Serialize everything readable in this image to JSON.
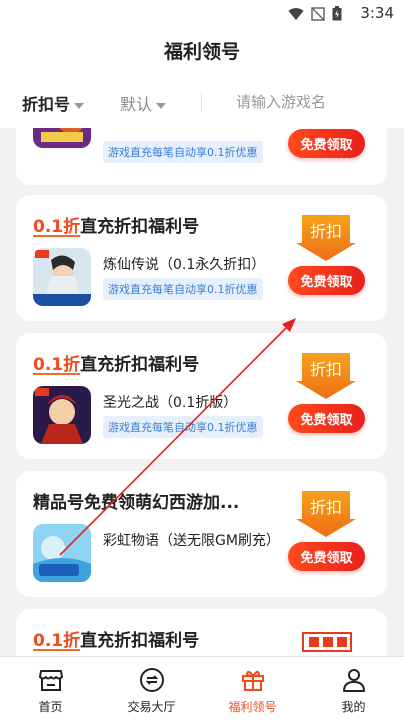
{
  "status": {
    "time": "3:34"
  },
  "header": {
    "title": "福利领号"
  },
  "filters": {
    "sort_label": "折扣号",
    "order_label": "默认",
    "search_placeholder": "请输入游戏名"
  },
  "cards": [
    {
      "title_highlight": "",
      "title_rest": "",
      "game": "",
      "promo": "游戏直充每笔自动享0.1折优惠",
      "button": "免费领取",
      "tag": ""
    },
    {
      "title_highlight": "0.1折",
      "title_rest": "直充折扣福利号",
      "game": "炼仙传说（0.1永久折扣）",
      "promo": "游戏直充每笔自动享0.1折优惠",
      "button": "免费领取",
      "tag": "折扣"
    },
    {
      "title_highlight": "0.1折",
      "title_rest": "直充折扣福利号",
      "game": "圣光之战（0.1折版）",
      "promo": "游戏直充每笔自动享0.1折优惠",
      "button": "免费领取",
      "tag": "折扣"
    },
    {
      "title_highlight": "",
      "title_rest": "精品号免费领萌幻西游加...",
      "game": "彩虹物语（送无限GM刷充）",
      "promo": "",
      "button": "免费领取",
      "tag": "折扣"
    },
    {
      "title_highlight": "0.1折",
      "title_rest": "直充折扣福利号",
      "game": "",
      "promo": "",
      "button": "",
      "tag": ""
    }
  ],
  "nav": [
    {
      "label": "首页",
      "icon": "store-icon"
    },
    {
      "label": "交易大厅",
      "icon": "exchange-icon"
    },
    {
      "label": "福利领号",
      "icon": "gift-icon"
    },
    {
      "label": "我的",
      "icon": "user-icon"
    }
  ],
  "colors": {
    "accent": "#f24b1c",
    "button": "#e8201c",
    "promo_text": "#3b7ed6",
    "promo_bg": "#e6f0fc",
    "tag": "#f08a1a"
  }
}
